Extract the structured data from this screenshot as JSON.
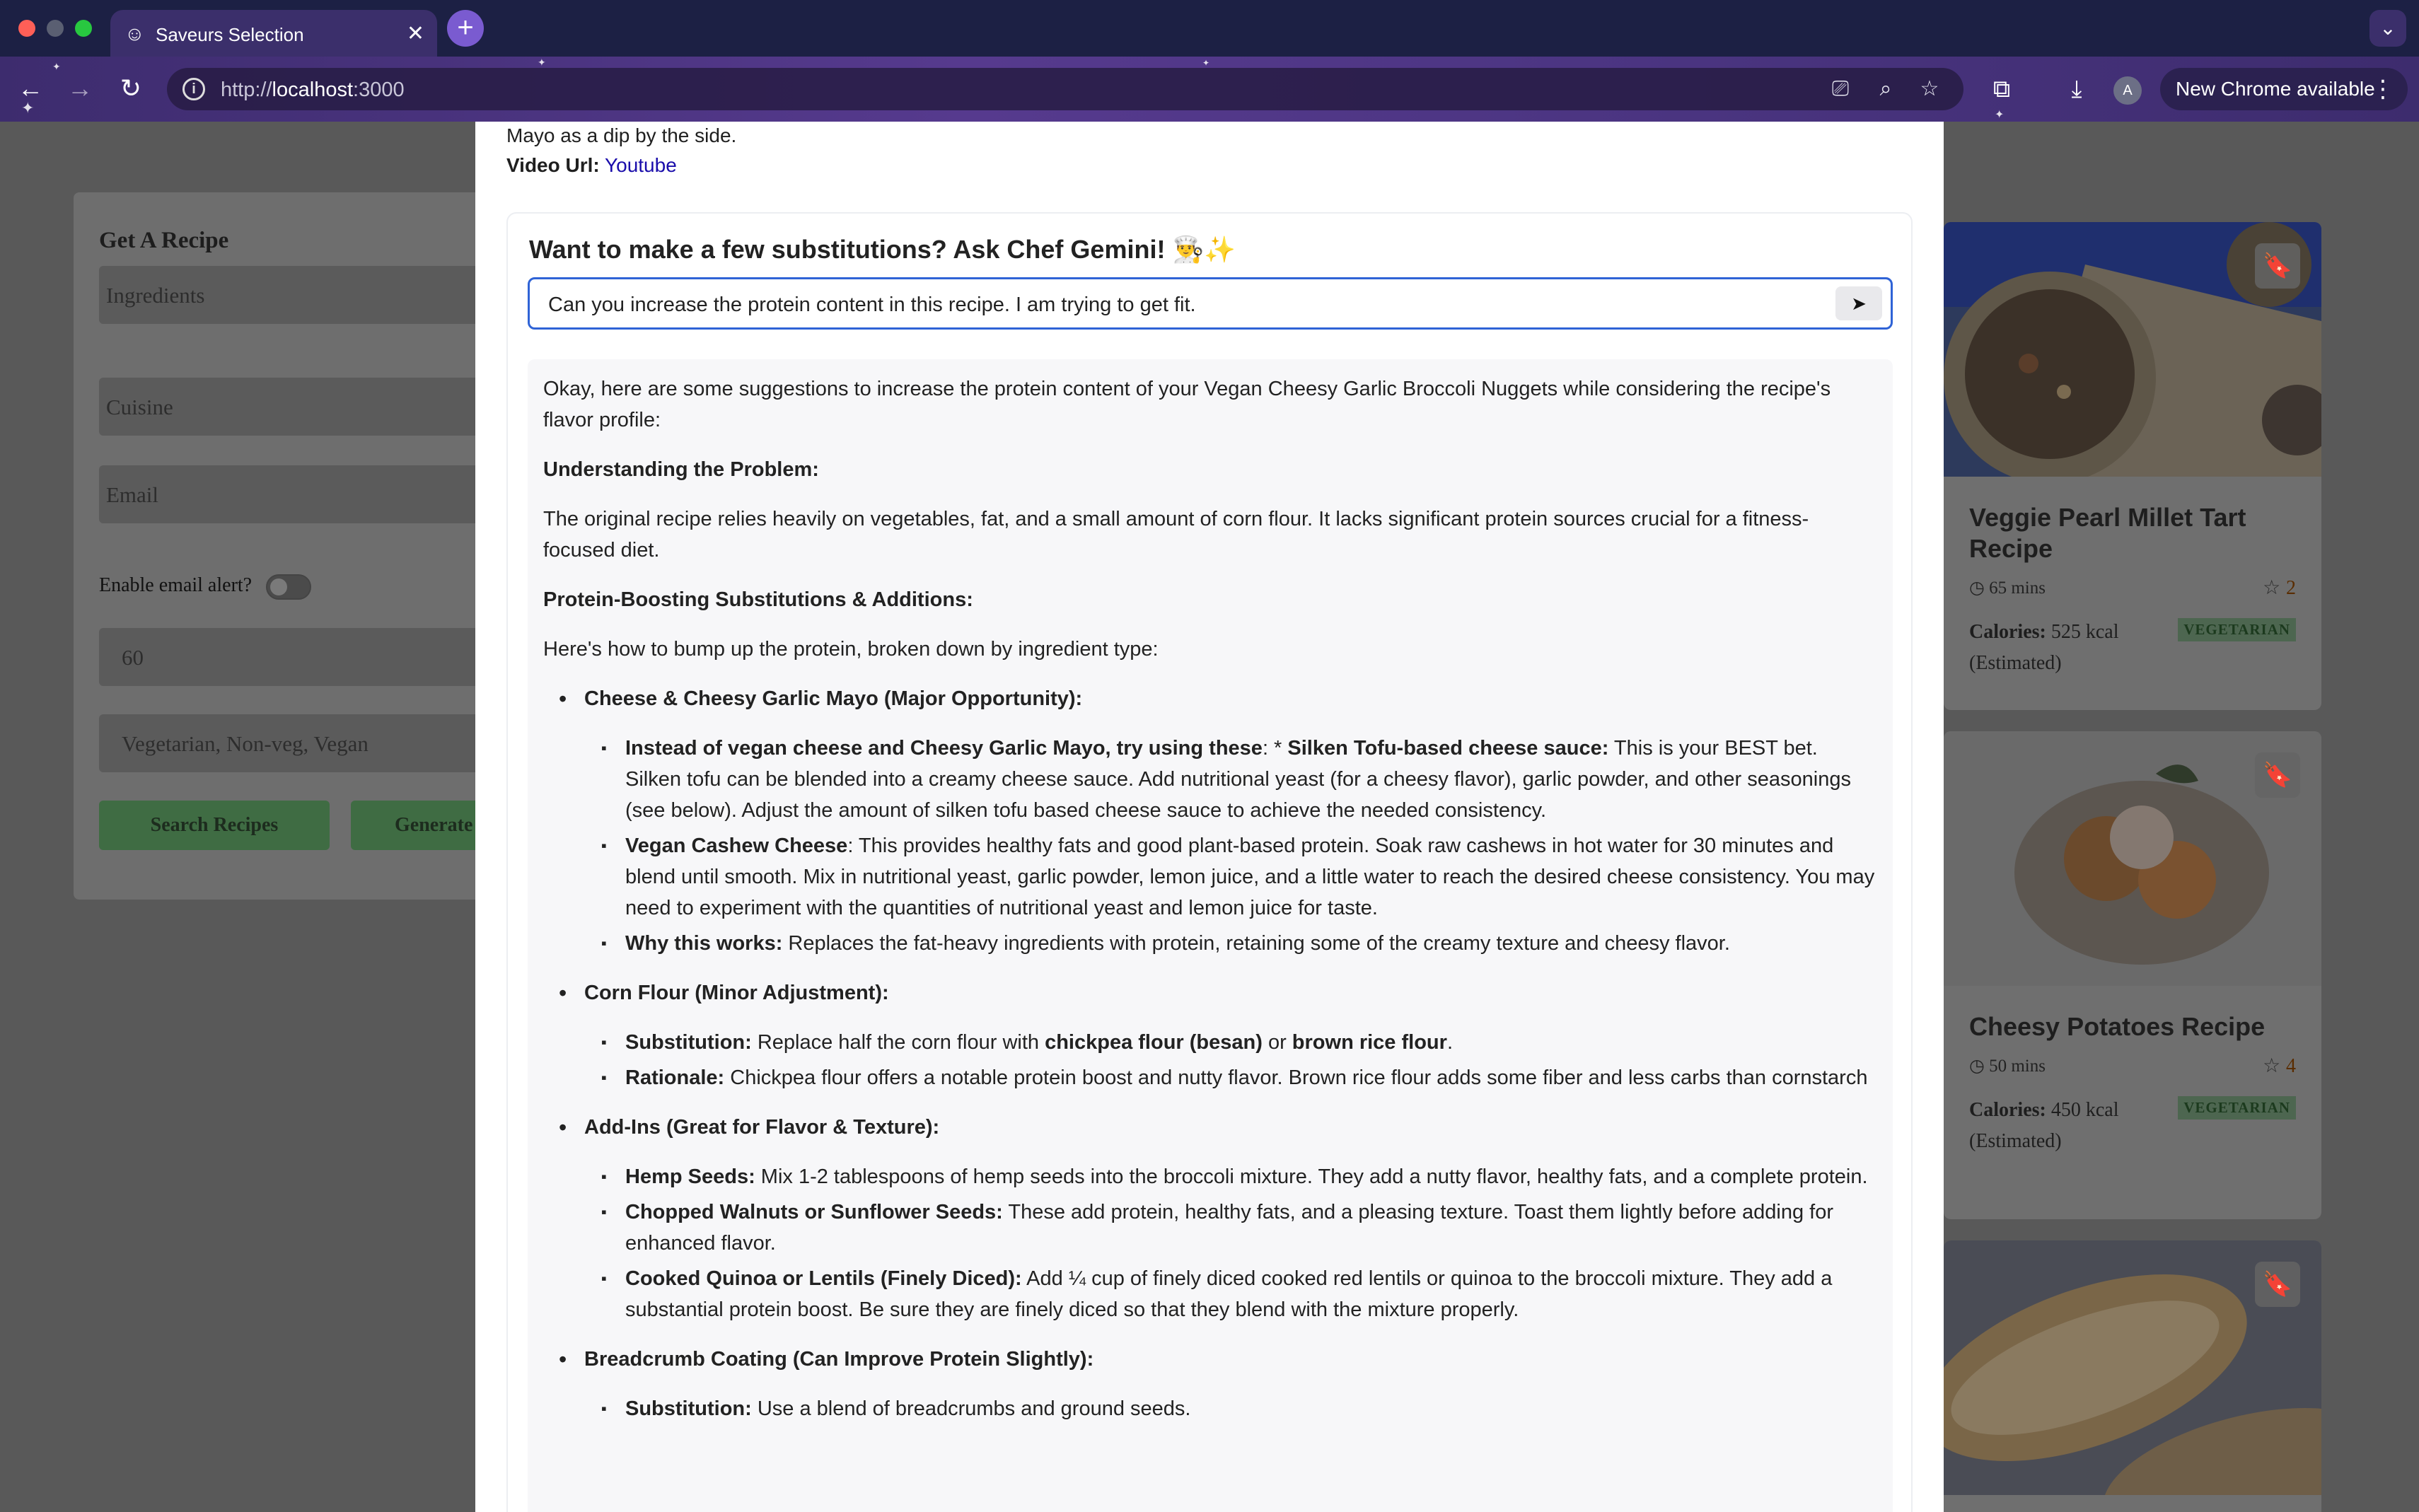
{
  "browser": {
    "tab_title": "Saveurs Selection",
    "url_prefix": "http://",
    "url_host": "localhost",
    "url_suffix": ":3000",
    "update_label": "New Chrome available",
    "profile_initial": "A"
  },
  "sidebar": {
    "title": "Get A Recipe",
    "ingredients_placeholder": "Ingredients",
    "cuisine_placeholder": "Cuisine",
    "email_placeholder": "Email",
    "email_alert_label": "Enable email alert?",
    "time_value": "60",
    "diet_placeholder": "Vegetarian, Non-veg, Vegan",
    "search_button": "Search Recipes",
    "generate_button": "Generate"
  },
  "recipe_cards": [
    {
      "title": "Veggie Pearl Millet Tart Recipe",
      "time": "65 mins",
      "rating": "2",
      "calories_label": "Calories:",
      "calories": "525 kcal",
      "estimated": "(Estimated)",
      "tag": "VEGETARIAN"
    },
    {
      "title": "Cheesy Potatoes Recipe",
      "time": "50 mins",
      "rating": "4",
      "calories_label": "Calories:",
      "calories": "450 kcal",
      "estimated": "(Estimated)",
      "tag": "VEGETARIAN"
    }
  ],
  "modal": {
    "top_line": "Mayo as a dip by the side.",
    "video_label": "Video Url:",
    "video_link": "Youtube",
    "chef_title": "Want to make a few substitutions? Ask Chef Gemini! 👨‍🍳✨",
    "chef_input_value": "Can you increase the protein content in this recipe. I am trying to get fit.",
    "answer": {
      "intro": "Okay, here are some suggestions to increase the protein content of your Vegan Cheesy Garlic Broccoli Nuggets while considering the recipe's flavor profile:",
      "h1": "Understanding the Problem:",
      "p1": "The original recipe relies heavily on vegetables, fat, and a small amount of corn flour. It lacks significant protein sources crucial for a fitness-focused diet.",
      "h2": "Protein-Boosting Substitutions & Additions:",
      "p2": "Here's how to bump up the protein, broken down by ingredient type:",
      "s1_title": "Cheese & Cheesy Garlic Mayo (Major Opportunity):",
      "s1_i1_bold": "Instead of vegan cheese and Cheesy Garlic Mayo, try using these",
      "s1_i1_mid": ": * ",
      "s1_i1_bold2": "Silken Tofu-based cheese sauce:",
      "s1_i1_text": " This is your BEST bet. Silken tofu can be blended into a creamy cheese sauce. Add nutritional yeast (for a cheesy flavor), garlic powder, and other seasonings (see below). Adjust the amount of silken tofu based cheese sauce to achieve the needed consistency.",
      "s1_i2_bold": "Vegan Cashew Cheese",
      "s1_i2_text": ": This provides healthy fats and good plant-based protein. Soak raw cashews in hot water for 30 minutes and blend until smooth. Mix in nutritional yeast, garlic powder, lemon juice, and a little water to reach the desired cheese consistency. You may need to experiment with the quantities of nutritional yeast and lemon juice for taste.",
      "s1_i3_bold": "Why this works:",
      "s1_i3_text": " Replaces the fat-heavy ingredients with protein, retaining some of the creamy texture and cheesy flavor.",
      "s2_title": "Corn Flour (Minor Adjustment):",
      "s2_i1_bold": "Substitution:",
      "s2_i1_text": " Replace half the corn flour with ",
      "s2_i1_bold2": "chickpea flour (besan)",
      "s2_i1_or": " or ",
      "s2_i1_bold3": "brown rice flour",
      "s2_i1_end": ".",
      "s2_i2_bold": "Rationale:",
      "s2_i2_text": " Chickpea flour offers a notable protein boost and nutty flavor. Brown rice flour adds some fiber and less carbs than cornstarch",
      "s3_title": "Add-Ins (Great for Flavor & Texture):",
      "s3_i1_bold": "Hemp Seeds:",
      "s3_i1_text": " Mix 1-2 tablespoons of hemp seeds into the broccoli mixture. They add a nutty flavor, healthy fats, and a complete protein.",
      "s3_i2_bold": "Chopped Walnuts or Sunflower Seeds:",
      "s3_i2_text": " These add protein, healthy fats, and a pleasing texture. Toast them lightly before adding for enhanced flavor.",
      "s3_i3_bold": "Cooked Quinoa or Lentils (Finely Diced):",
      "s3_i3_text": " Add ¼ cup of finely diced cooked red lentils or quinoa to the broccoli mixture. They add a substantial protein boost. Be sure they are finely diced so that they blend with the mixture properly.",
      "s4_title": "Breadcrumb Coating (Can Improve Protein Slightly):",
      "s4_i1_bold": "Substitution:",
      "s4_i1_text": " Use a blend of breadcrumbs and ground seeds."
    }
  },
  "colors": {
    "accent_blue": "#2f63d6",
    "link": "#1a0dab",
    "overlay": "#595959"
  }
}
